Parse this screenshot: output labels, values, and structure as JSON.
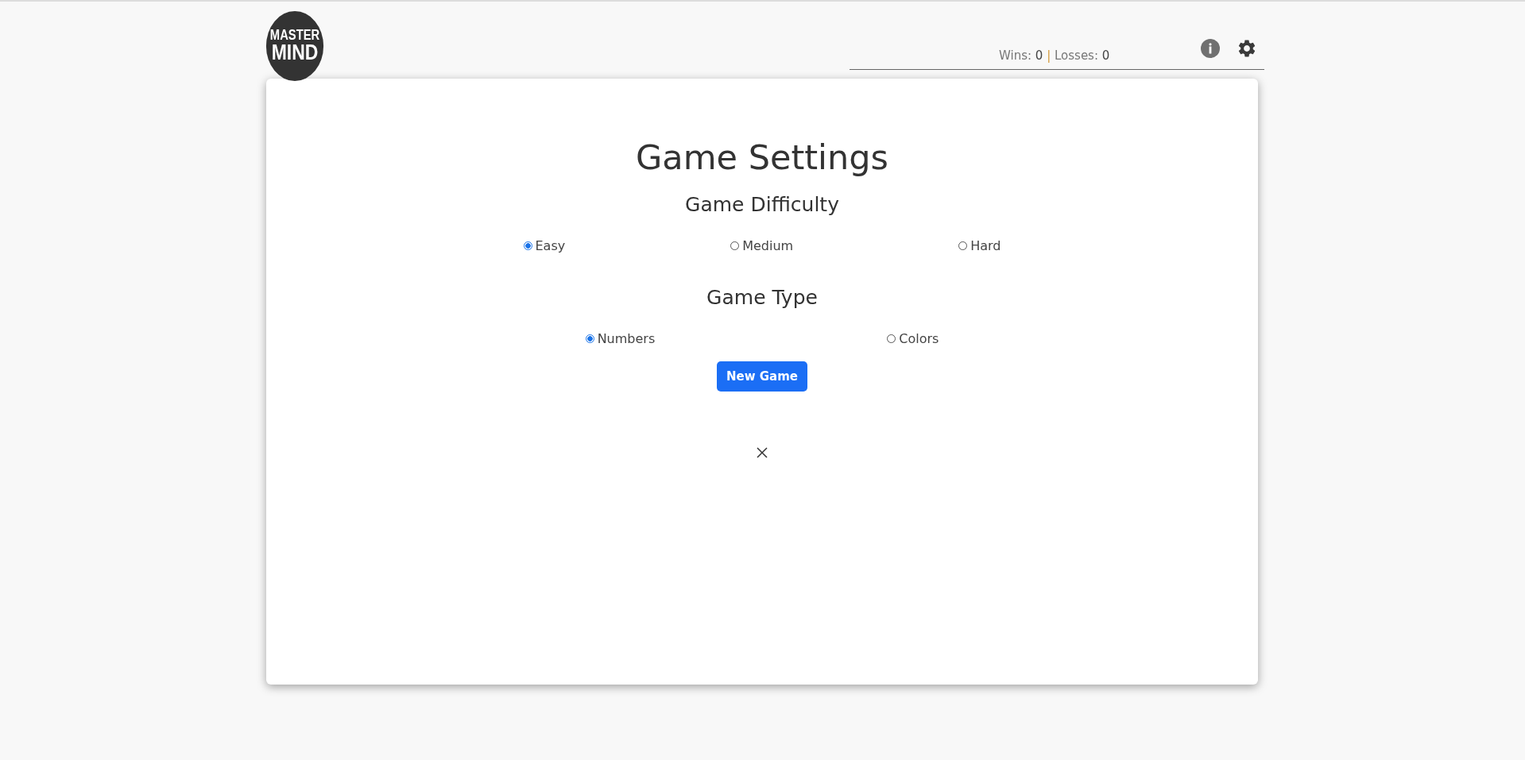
{
  "logo": {
    "line_1": "MASTER",
    "line_2": "MIND"
  },
  "score": {
    "wins_label": "Wins:",
    "wins": "0",
    "separator": "|",
    "losses_label": "Losses:",
    "losses": "0"
  },
  "modal": {
    "title": "Game Settings",
    "difficulty": {
      "heading": "Game Difficulty",
      "options": [
        {
          "label": "Easy",
          "selected": true
        },
        {
          "label": "Medium",
          "selected": false
        },
        {
          "label": "Hard",
          "selected": false
        }
      ]
    },
    "game_type": {
      "heading": "Game Type",
      "options": [
        {
          "label": "Numbers",
          "selected": true
        },
        {
          "label": "Colors",
          "selected": false
        }
      ]
    },
    "button": "New Game"
  }
}
